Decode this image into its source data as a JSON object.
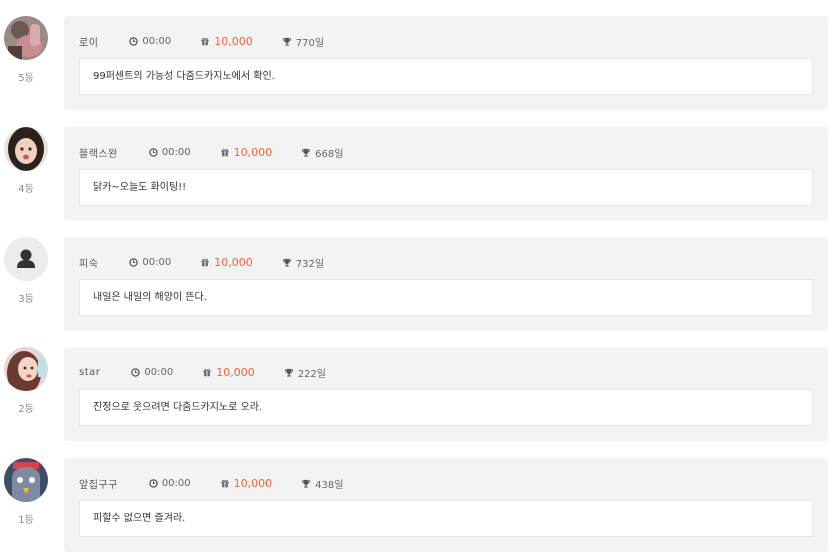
{
  "entries": [
    {
      "user": "로이",
      "time": "00:00",
      "money": "10,000",
      "days": "770일",
      "rank": "5등",
      "message": "99퍼센트의 가능성 다줌드카지노에서 확인."
    },
    {
      "user": "블랙스완",
      "time": "00:00",
      "money": "10,000",
      "days": "668일",
      "rank": "4등",
      "message": "닭카~오늘도 화이팅!!"
    },
    {
      "user": "피숙",
      "time": "00:00",
      "money": "10,000",
      "days": "732일",
      "rank": "3등",
      "message": "내일은 내일의 해양이 뜬다."
    },
    {
      "user": "star",
      "time": "00:00",
      "money": "10,000",
      "days": "222일",
      "rank": "2등",
      "message": "진정으로 웃으려면 다줌드카지노로 오라."
    },
    {
      "user": "앞집구구",
      "time": "00:00",
      "money": "10,000",
      "days": "438일",
      "rank": "1등",
      "message": "피할수 없으면 즐겨라."
    }
  ],
  "colors": {
    "money": "#ef6433",
    "card": "#f3f3f3"
  },
  "icons": {
    "time": "clock-icon",
    "money": "gift-icon",
    "days": "trophy-icon",
    "default_avatar": "user-silhouette-icon"
  }
}
